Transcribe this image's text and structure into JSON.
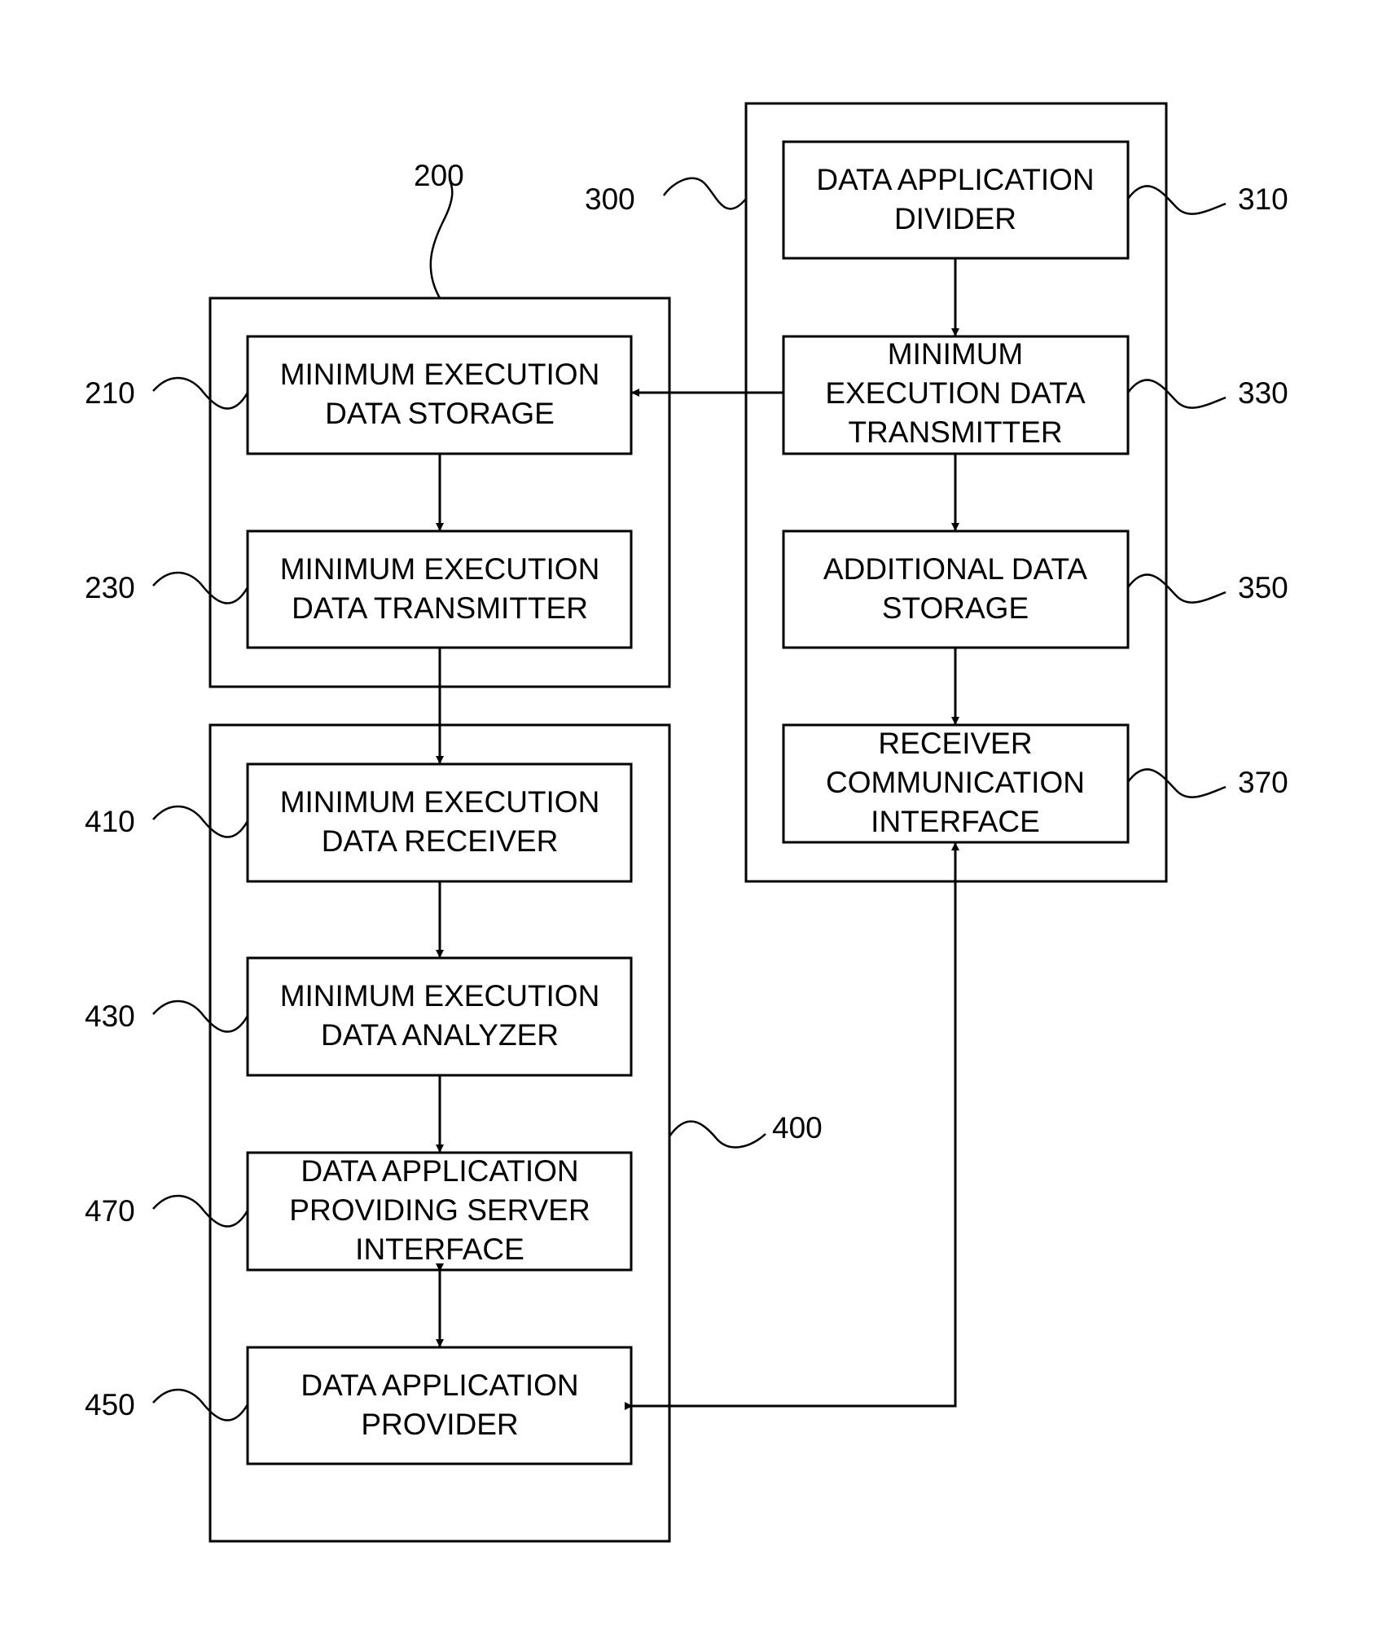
{
  "figure": {
    "groups": [
      {
        "id": "200",
        "label": "200"
      },
      {
        "id": "300",
        "label": "300"
      },
      {
        "id": "400",
        "label": "400"
      }
    ],
    "blocks": {
      "b310": {
        "ref": "310",
        "lines": [
          "DATA APPLICATION",
          "DIVIDER"
        ]
      },
      "b330": {
        "ref": "330",
        "lines": [
          "MINIMUM",
          "EXECUTION DATA",
          "TRANSMITTER"
        ]
      },
      "b350": {
        "ref": "350",
        "lines": [
          "ADDITIONAL DATA",
          "STORAGE"
        ]
      },
      "b370": {
        "ref": "370",
        "lines": [
          "RECEIVER",
          "COMMUNICATION",
          "INTERFACE"
        ]
      },
      "b210": {
        "ref": "210",
        "lines": [
          "MINIMUM EXECUTION",
          "DATA STORAGE"
        ]
      },
      "b230": {
        "ref": "230",
        "lines": [
          "MINIMUM EXECUTION",
          "DATA TRANSMITTER"
        ]
      },
      "b410": {
        "ref": "410",
        "lines": [
          "MINIMUM EXECUTION",
          "DATA RECEIVER"
        ]
      },
      "b430": {
        "ref": "430",
        "lines": [
          "MINIMUM EXECUTION",
          "DATA ANALYZER"
        ]
      },
      "b470": {
        "ref": "470",
        "lines": [
          "DATA APPLICATION",
          "PROVIDING SERVER",
          "INTERFACE"
        ]
      },
      "b450": {
        "ref": "450",
        "lines": [
          "DATA APPLICATION",
          "PROVIDER"
        ]
      }
    },
    "connections": [
      {
        "from": "310",
        "to": "330",
        "type": "arrow"
      },
      {
        "from": "330",
        "to": "350",
        "type": "arrow"
      },
      {
        "from": "350",
        "to": "370",
        "type": "arrow"
      },
      {
        "from": "330",
        "to": "210",
        "type": "arrow"
      },
      {
        "from": "210",
        "to": "230",
        "type": "arrow"
      },
      {
        "from": "230",
        "to": "410",
        "type": "arrow"
      },
      {
        "from": "410",
        "to": "430",
        "type": "arrow"
      },
      {
        "from": "430",
        "to": "470",
        "type": "arrow"
      },
      {
        "from": "470",
        "to": "450",
        "type": "bidirectional"
      },
      {
        "from": "370",
        "to": "450",
        "type": "bidirectional"
      }
    ]
  }
}
